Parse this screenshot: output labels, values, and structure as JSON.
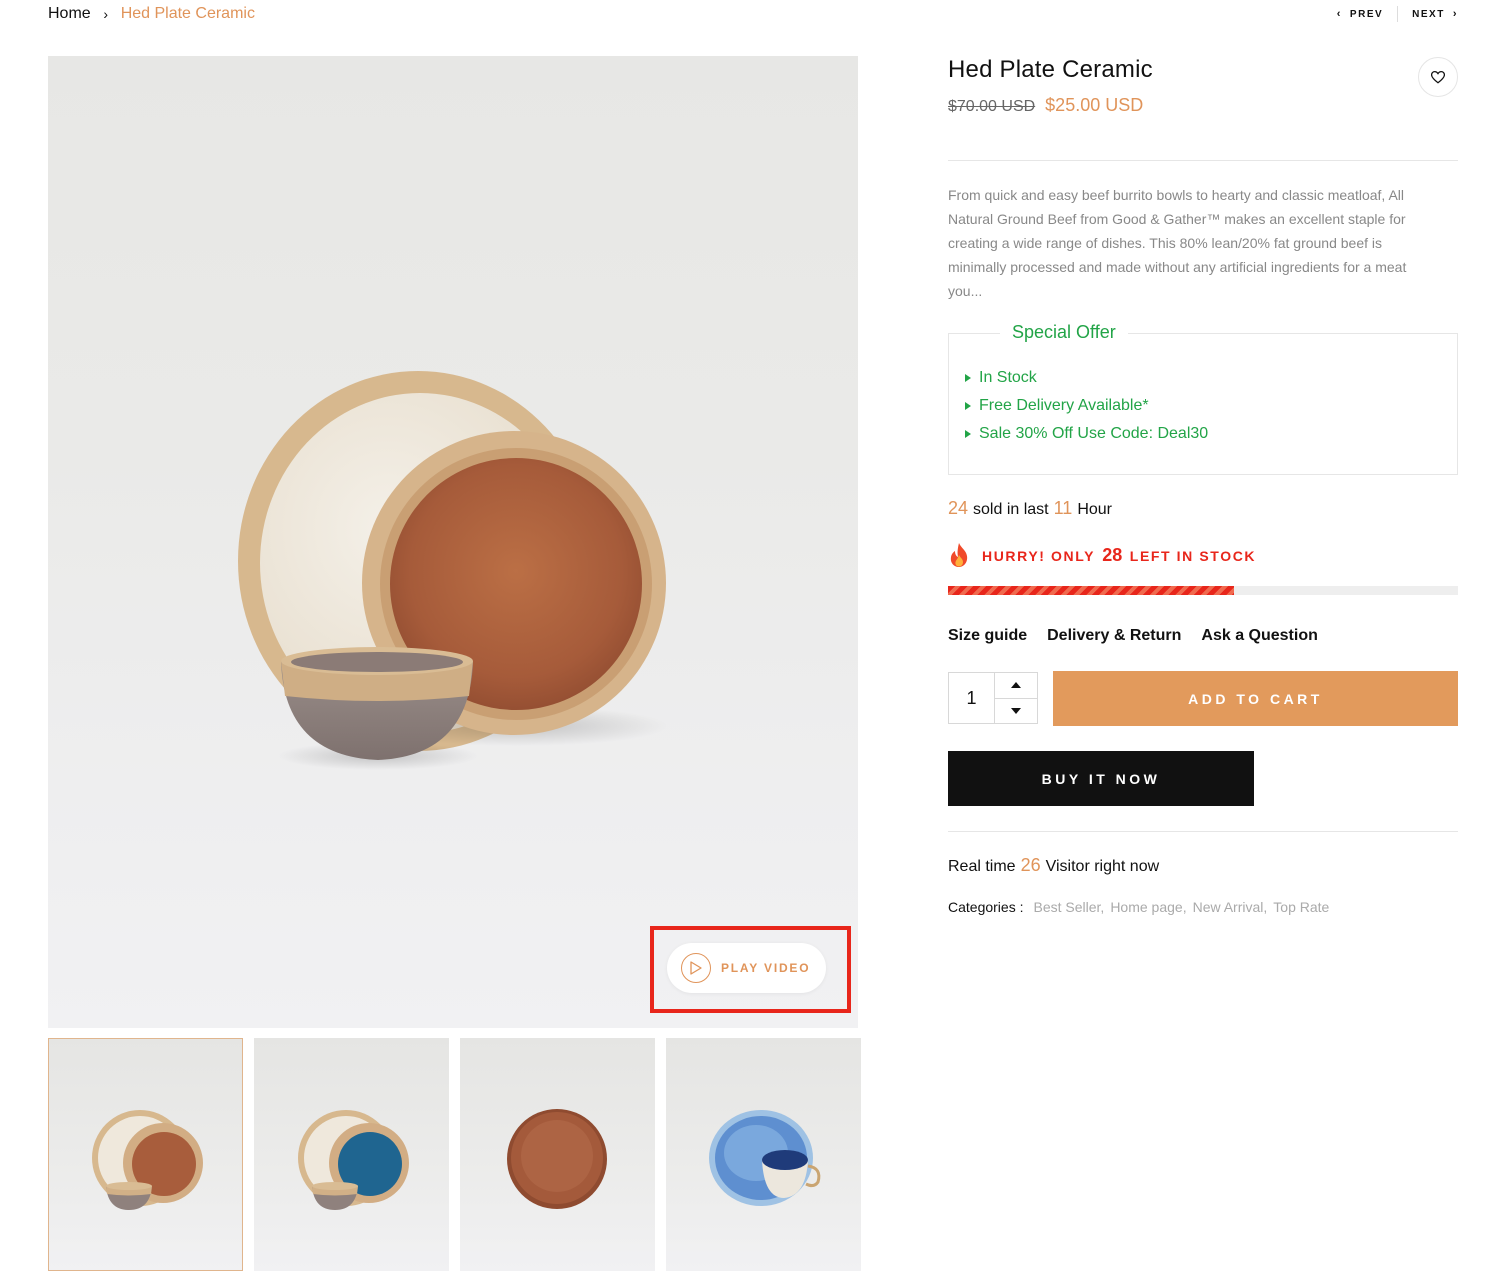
{
  "breadcrumb": {
    "home": "Home",
    "separator": "›",
    "current": "Hed Plate Ceramic"
  },
  "nav": {
    "prev": "PREV",
    "next": "NEXT"
  },
  "gallery": {
    "play_video": "PLAY VIDEO",
    "thumbnails": [
      "tan plate set",
      "blue plate set",
      "brown plate",
      "blue plate with cup"
    ]
  },
  "product": {
    "title": "Hed Plate Ceramic",
    "old_price": "$70.00 USD",
    "new_price": "$25.00 USD",
    "description": "From quick and easy beef burrito bowls to hearty and classic meatloaf, All Natural Ground Beef from Good & Gather™ makes an excellent staple for creating a wide range of dishes. This 80% lean/20% fat ground beef is minimally processed and made without any artificial ingredients for a meat you..."
  },
  "offer": {
    "title": "Special Offer",
    "items": [
      "In Stock",
      "Free Delivery Available*",
      "Sale 30% Off Use Code: Deal30"
    ]
  },
  "sold": {
    "count": "24",
    "text_mid": "sold in last",
    "hours": "11",
    "text_end": "Hour"
  },
  "stock": {
    "prefix": "HURRY! ONLY",
    "count": "28",
    "suffix": "LEFT IN STOCK",
    "progress_fraction": 0.56
  },
  "links": {
    "size_guide": "Size guide",
    "delivery": "Delivery & Return",
    "ask": "Ask a Question"
  },
  "quantity": "1",
  "buttons": {
    "add_to_cart": "ADD TO CART",
    "buy_now": "BUY IT NOW"
  },
  "visitors": {
    "prefix": "Real time",
    "count": "26",
    "suffix": "Visitor right now"
  },
  "categories": {
    "label": "Categories :",
    "items": [
      "Best Seller,",
      "Home page,",
      "New Arrival,",
      "Top Rate"
    ]
  },
  "colors": {
    "accent": "#e0945a",
    "green": "#22a447",
    "red": "#e8261b",
    "dark": "#111111"
  }
}
